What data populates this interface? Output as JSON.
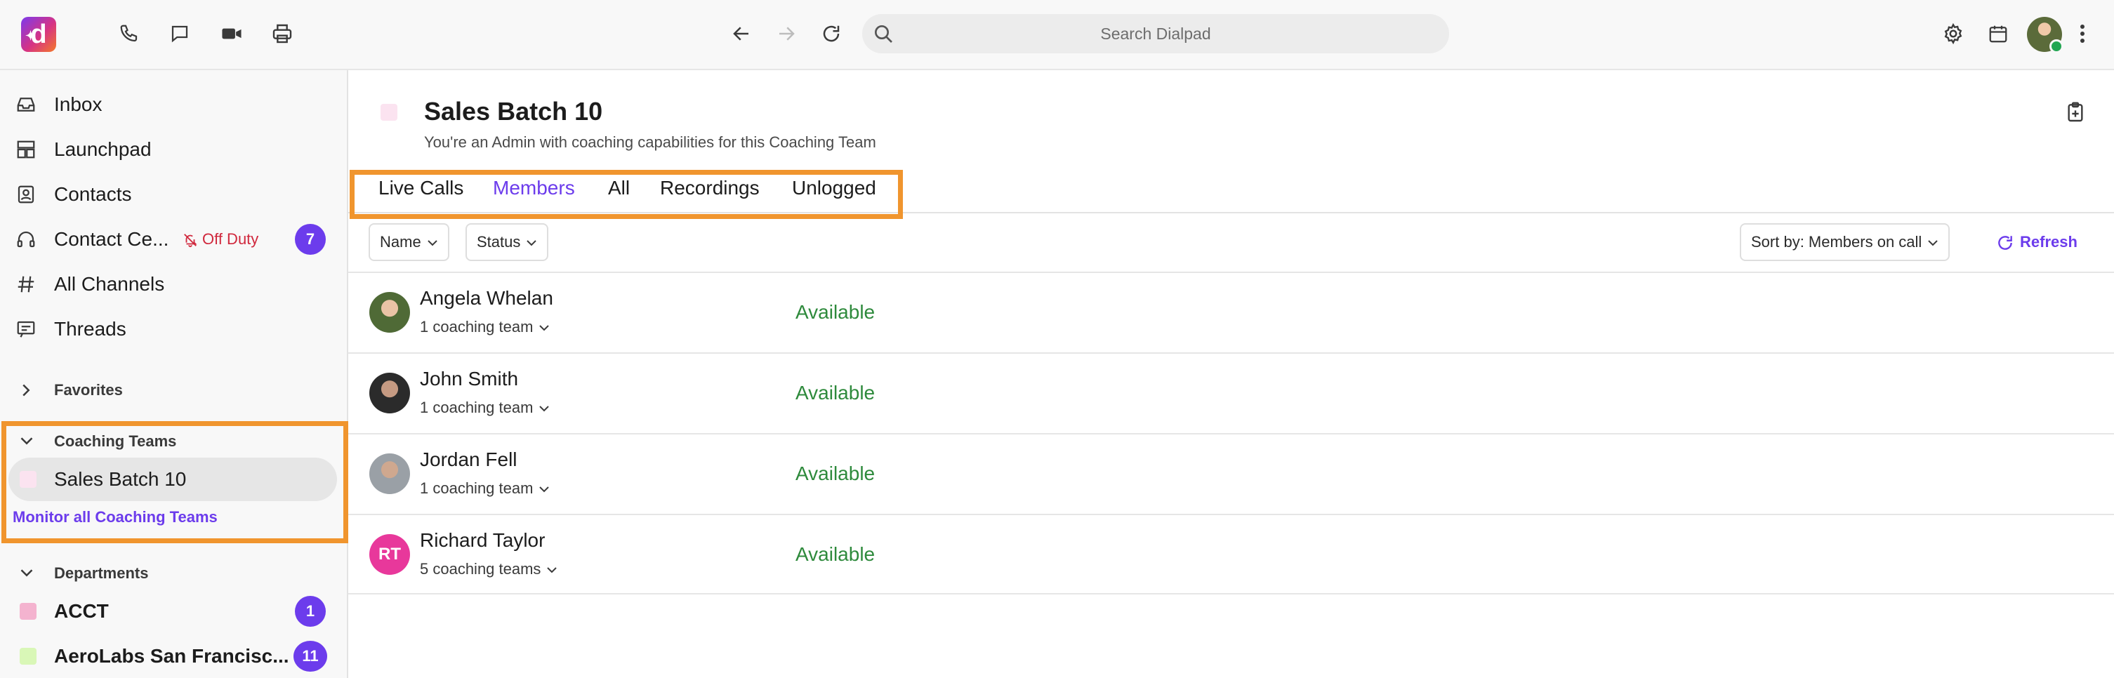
{
  "topbar": {
    "logo_letter": "d",
    "search_placeholder": "Search Dialpad",
    "icons": [
      "phone-icon",
      "chat-icon",
      "video-icon",
      "print-icon",
      "back-arrow-icon",
      "forward-arrow-icon",
      "reload-icon",
      "gear-icon",
      "calendar-icon",
      "kebab-menu-icon"
    ]
  },
  "sidebar": {
    "nav": [
      {
        "label": "Inbox",
        "icon": "inbox-icon"
      },
      {
        "label": "Launchpad",
        "icon": "launchpad-icon"
      },
      {
        "label": "Contacts",
        "icon": "contacts-icon"
      },
      {
        "label": "Contact Ce...",
        "icon": "headset-icon",
        "status": "Off Duty",
        "badge": "7"
      },
      {
        "label": "All Channels",
        "icon": "hash-icon"
      },
      {
        "label": "Threads",
        "icon": "threads-icon"
      }
    ],
    "favorites_label": "Favorites",
    "coaching_label": "Coaching Teams",
    "coaching_items": [
      {
        "label": "Sales Batch 10",
        "color": "#fbe3f0"
      }
    ],
    "monitor_link": "Monitor all Coaching Teams",
    "departments_label": "Departments",
    "departments": [
      {
        "label": "ACCT",
        "color": "#f4b3cf",
        "badge": "1"
      },
      {
        "label": "AeroLabs San Francisc...",
        "color": "#d9f7b7",
        "badge": "11"
      }
    ]
  },
  "main": {
    "title": "Sales Batch 10",
    "subtitle": "You're an Admin with coaching capabilities for this Coaching Team",
    "tabs": [
      "Live Calls",
      "Members",
      "All",
      "Recordings",
      "Unlogged"
    ],
    "active_tab": "Members",
    "filters": {
      "name": "Name",
      "status": "Status",
      "sort": "Sort by: Members on call"
    },
    "refresh_label": "Refresh",
    "members": [
      {
        "name": "Angela Whelan",
        "teams": "1 coaching team",
        "status": "Available"
      },
      {
        "name": "John Smith",
        "teams": "1 coaching team",
        "status": "Available"
      },
      {
        "name": "Jordan Fell",
        "teams": "1 coaching team",
        "status": "Available"
      },
      {
        "name": "Richard Taylor",
        "teams": "5 coaching teams",
        "status": "Available",
        "initials": "RT"
      }
    ]
  },
  "colors": {
    "accent": "#6c3cec",
    "highlight": "#f0952e",
    "available": "#2e8a3c",
    "off_duty": "#d0283d"
  }
}
